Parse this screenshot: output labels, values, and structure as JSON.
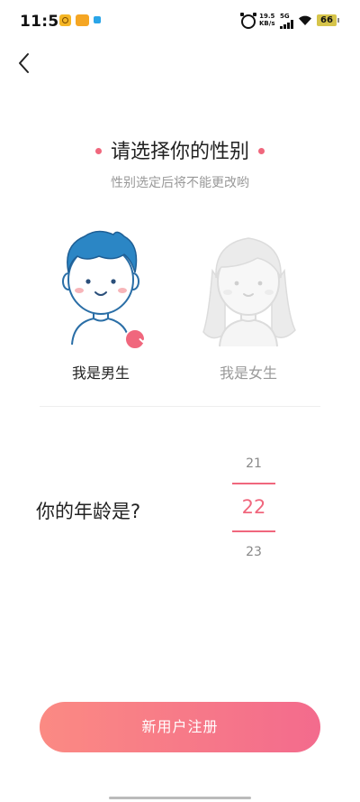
{
  "status_bar": {
    "time": "11:54",
    "net_speed_value": "19.5",
    "net_speed_unit": "KB/s",
    "network_type": "5G",
    "battery_level": "66"
  },
  "nav": {
    "back_icon": "chevron-left-icon"
  },
  "header": {
    "title": "请选择你的性别",
    "subtitle": "性别选定后将不能更改哟"
  },
  "gender": {
    "options": [
      {
        "label": "我是男生",
        "selected": true,
        "icon": "male-avatar-icon"
      },
      {
        "label": "我是女生",
        "selected": false,
        "icon": "female-avatar-icon"
      }
    ]
  },
  "age": {
    "label": "你的年龄是?",
    "options": [
      "21",
      "22",
      "23"
    ],
    "selected": "22"
  },
  "actions": {
    "register_label": "新用户注册"
  },
  "colors": {
    "accent": "#f0677d",
    "male_hair": "#2b86c5",
    "button_gradient_start": "#fb8a83",
    "button_gradient_end": "#f36b8d"
  }
}
